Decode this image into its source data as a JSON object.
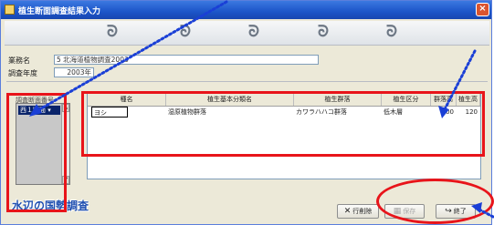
{
  "window": {
    "title": "植生断面調査結果入力",
    "close_glyph": "×"
  },
  "ribbon": {
    "curl_glyph": "ᘐ"
  },
  "info": {
    "business_name_label": "業務名",
    "business_name_value": "5 北海道植物調査2003",
    "survey_year_label": "調査年度",
    "survey_year_value": "2003年"
  },
  "left_panel": {
    "label": "調査断面番号",
    "selected_item": "西１断面 ▾"
  },
  "table": {
    "headers": [
      "種名",
      "植生基本分類名",
      "植生群落",
      "植生区分",
      "群落高",
      "植生高"
    ],
    "rows": [
      [
        "ヨシ",
        "湿原植物群落",
        "カワラハハコ群落",
        "低木層",
        "100",
        "120"
      ]
    ]
  },
  "bottom": {
    "title": "水辺の国勢調査",
    "buttons": {
      "delete_row": "行削除",
      "save": "保存",
      "exit": "終了"
    }
  },
  "colors": {
    "annotation_red": "#e8141a",
    "pointer_blue": "#1a3fd6",
    "title_blue": "#1f4fb0"
  }
}
